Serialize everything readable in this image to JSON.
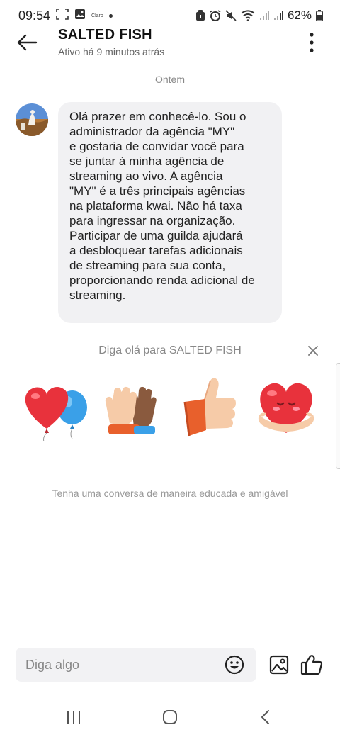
{
  "status_bar": {
    "time": "09:54",
    "carrier_small": "Claro",
    "battery": "62%"
  },
  "header": {
    "contact_name": "SALTED FISH",
    "contact_status": "Ativo há 9 minutos atrás"
  },
  "chat": {
    "date_separator": "Ontem",
    "messages": [
      {
        "sender": "SALTED FISH",
        "text": "Olá prazer em conhecê-lo. Sou o\nadministrador da agência \"MY\"\ne gostaria de convidar você para\nse juntar à minha agência de\nstreaming ao vivo. A agência\n\"MY\" é a três principais agências\nna plataforma kwai. Não há taxa\npara ingressar na organização.\nParticipar de uma guilda ajudará\na desbloquear tarefas adicionais\nde streaming para sua conta,\nproporcionando renda adicional de\nstreaming."
      }
    ]
  },
  "greeting": {
    "title": "Diga olá para SALTED FISH",
    "stickers": [
      "heart-balloon",
      "high-five",
      "thumbs-up",
      "heart-hug"
    ]
  },
  "polite_note": "Tenha uma conversa de maneira educada e amigável",
  "compose": {
    "placeholder": "Diga algo"
  },
  "colors": {
    "bubble_bg": "#f1f1f3",
    "muted_text": "#888888",
    "heart_red": "#e8323c"
  }
}
